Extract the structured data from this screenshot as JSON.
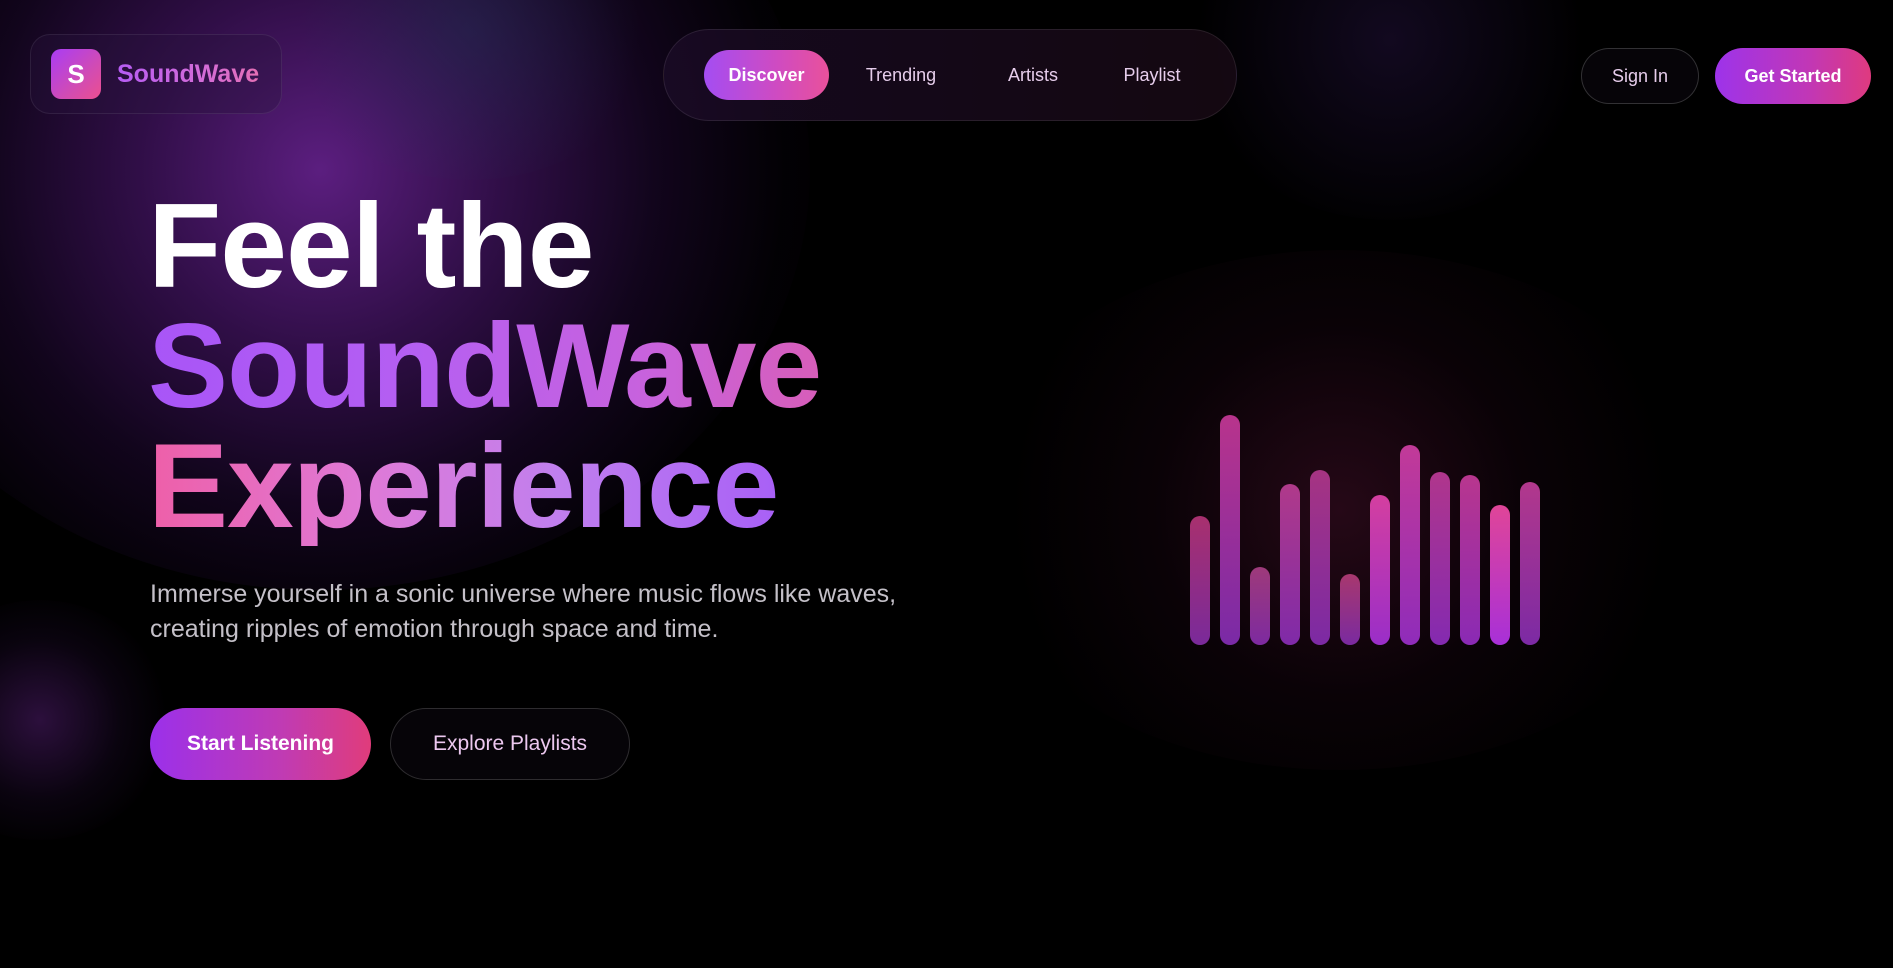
{
  "brand": {
    "logo_letter": "S",
    "name": "SoundWave"
  },
  "nav": {
    "items": [
      {
        "label": "Discover",
        "active": true
      },
      {
        "label": "Trending",
        "active": false
      },
      {
        "label": "Artists",
        "active": false
      },
      {
        "label": "Playlist",
        "active": false
      }
    ]
  },
  "header_actions": {
    "sign_in": "Sign In",
    "get_started": "Get Started"
  },
  "hero": {
    "line1": "Feel the",
    "line2": "SoundWave",
    "line3": "Experience",
    "subtitle": "Immerse yourself in a sonic universe where music flows like waves, creating ripples of emotion through space and time.",
    "primary_cta": "Start Listening",
    "secondary_cta": "Explore Playlists"
  },
  "equalizer": {
    "levels": [
      0.56,
      1.0,
      0.34,
      0.7,
      0.76,
      0.31,
      0.65,
      0.87,
      0.75,
      0.74,
      0.61,
      0.71
    ]
  },
  "colors": {
    "background": "#000000",
    "accent_purple": "#a855f7",
    "accent_pink": "#e03c7b",
    "nav_text": "#e6cdeb",
    "subtitle_text": "#c4c0c8"
  }
}
